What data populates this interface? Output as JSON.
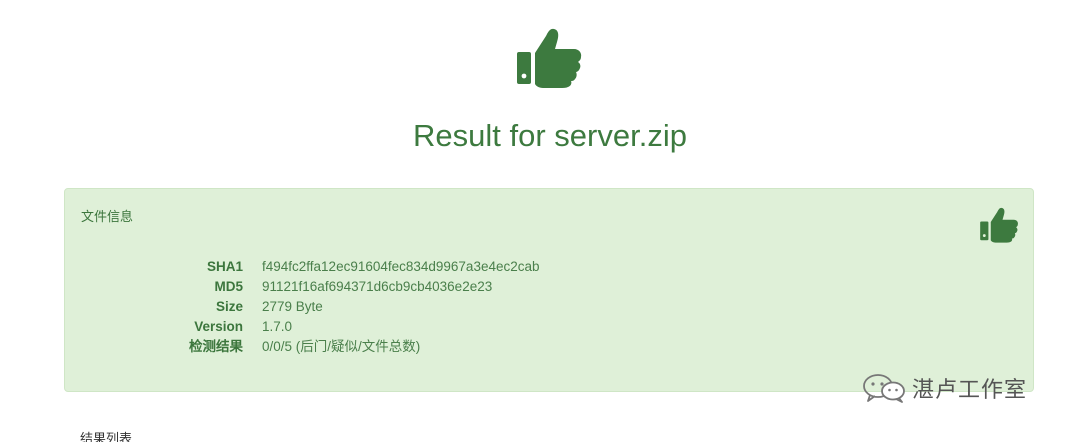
{
  "header": {
    "icon": "thumbs-up-icon",
    "title": "Result for server.zip",
    "accent_color": "#3d7a3f"
  },
  "file_panel": {
    "title": "文件信息",
    "icon": "thumbs-up-icon",
    "background_color": "#dff0d8",
    "rows": [
      {
        "label": "SHA1",
        "value": "f494fc2ffa12ec91604fec834d9967a3e4ec2cab"
      },
      {
        "label": "MD5",
        "value": "91121f16af694371d6cb9cb4036e2e23"
      },
      {
        "label": "Size",
        "value": "2779 Byte"
      },
      {
        "label": "Version",
        "value": "1.7.0"
      },
      {
        "label": "检测结果",
        "value": "0/0/5 (后门/疑似/文件总数)"
      }
    ]
  },
  "watermark": {
    "icon": "wechat-icon",
    "text": "湛卢工作室"
  },
  "results": {
    "title": "结果列表"
  }
}
